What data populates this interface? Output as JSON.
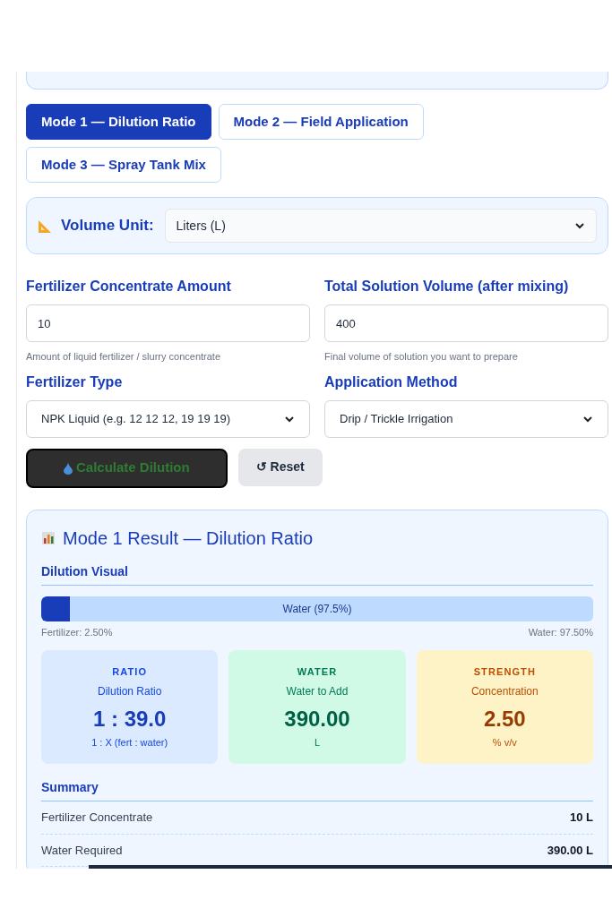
{
  "modes": [
    {
      "label": "Mode 1 — Dilution Ratio",
      "selected": true
    },
    {
      "label": "Mode 2 — Field Application",
      "selected": false
    },
    {
      "label": "Mode 3 — Spray Tank Mix",
      "selected": false
    }
  ],
  "unit": {
    "label": "Volume Unit:",
    "value": "Liters (L)"
  },
  "fields": [
    {
      "kind": "input",
      "label": "Fertilizer Concentrate Amount",
      "value": "10",
      "hint": "Amount of liquid fertilizer / slurry concentrate"
    },
    {
      "kind": "input",
      "label": "Total Solution Volume (after mixing)",
      "value": "400",
      "hint": "Final volume of solution you want to prepare"
    },
    {
      "kind": "select",
      "label": "Fertilizer Type",
      "value": "NPK Liquid (e.g. 12 12 12, 19 19 19)"
    },
    {
      "kind": "select",
      "label": "Application Method",
      "value": "Drip / Trickle Irrigation"
    }
  ],
  "buttons": {
    "calculate": "Calculate Dilution",
    "reset": "↺ Reset"
  },
  "result": {
    "title": "Mode 1 Result — Dilution Ratio",
    "visual_heading": "Dilution Visual",
    "bar": {
      "level": 0.025,
      "label": "Water (97.5%)",
      "left_caption": "Fertilizer: 2.50%",
      "right_caption": "Water: 97.50%"
    },
    "stats": [
      {
        "kind": "ratio",
        "tag": "RATIO",
        "title": "Dilution Ratio",
        "value": "1 : 39.0",
        "unit": "1 : X (fert : water)"
      },
      {
        "kind": "water",
        "tag": "WATER",
        "title": "Water to Add",
        "value": "390.00",
        "unit": "L"
      },
      {
        "kind": "strength",
        "tag": "STRENGTH",
        "title": "Concentration",
        "value": "2.50",
        "unit": "% v/v"
      }
    ],
    "summary_heading": "Summary",
    "summary": [
      {
        "label": "Fertilizer Concentrate",
        "value": "10 L"
      },
      {
        "label": "Water Required",
        "value": "390.00 L"
      }
    ]
  }
}
